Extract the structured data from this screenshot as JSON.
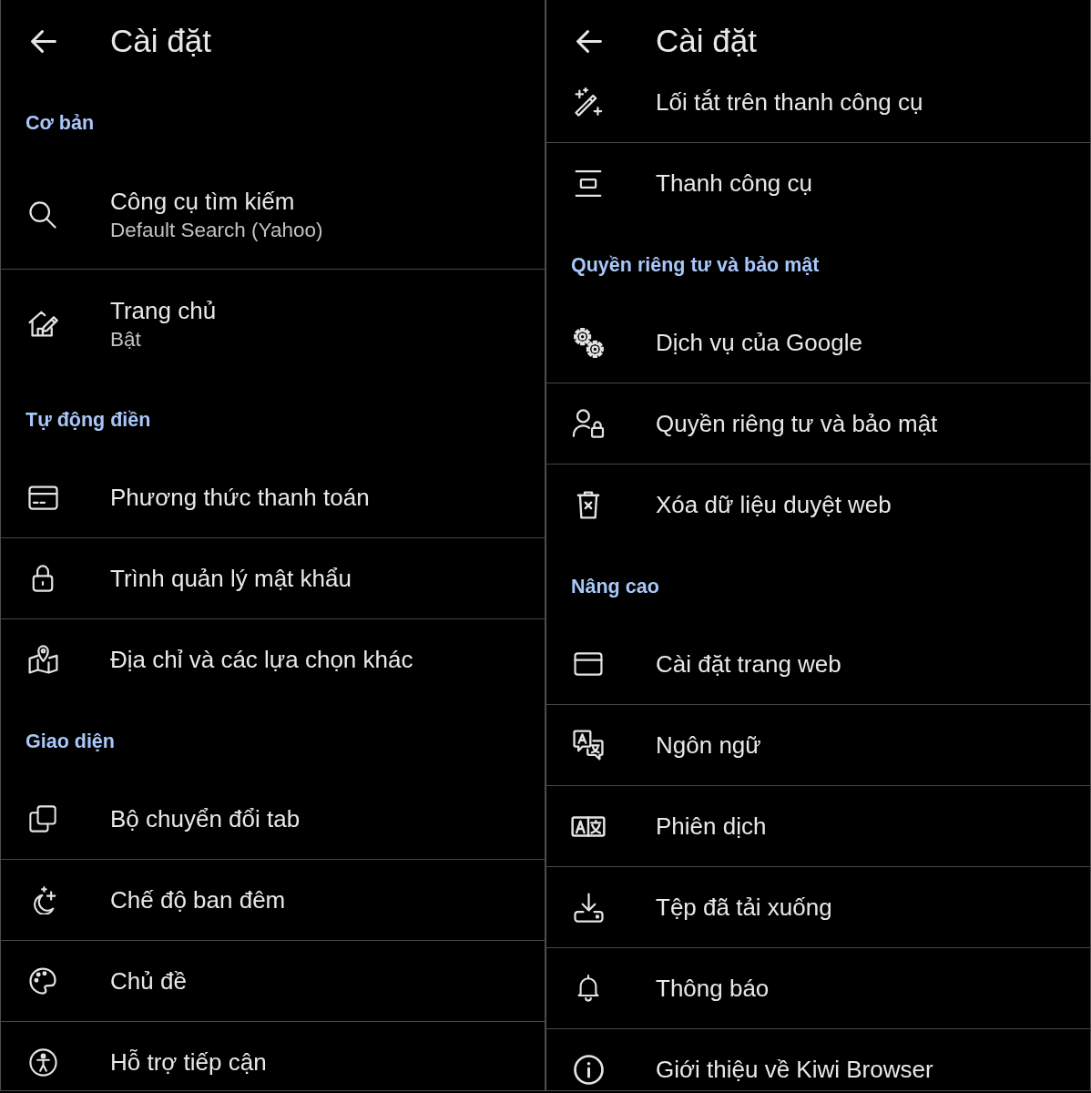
{
  "screens": [
    {
      "title": "Cài đặt",
      "sections": [
        {
          "heading": "Cơ bản",
          "items": [
            {
              "label": "Công cụ tìm kiếm",
              "summary": "Default Search (Yahoo)"
            },
            {
              "label": "Trang chủ",
              "summary": "Bật"
            }
          ]
        },
        {
          "heading": "Tự động điền",
          "items": [
            {
              "label": "Phương thức thanh toán"
            },
            {
              "label": "Trình quản lý mật khẩu"
            },
            {
              "label": "Địa chỉ và các lựa chọn khác"
            }
          ]
        },
        {
          "heading": "Giao diện",
          "items": [
            {
              "label": "Bộ chuyển đổi tab"
            },
            {
              "label": "Chế độ ban đêm"
            },
            {
              "label": "Chủ đề"
            },
            {
              "label": "Hỗ trợ tiếp cận"
            }
          ]
        }
      ]
    },
    {
      "title": "Cài đặt",
      "sections": [
        {
          "items": [
            {
              "label": "Lối tắt trên thanh công cụ"
            },
            {
              "label": "Thanh công cụ"
            }
          ]
        },
        {
          "heading": "Quyền riêng tư và bảo mật",
          "items": [
            {
              "label": "Dịch vụ của Google"
            },
            {
              "label": "Quyền riêng tư và bảo mật"
            },
            {
              "label": "Xóa dữ liệu duyệt web"
            }
          ]
        },
        {
          "heading": "Nâng cao",
          "items": [
            {
              "label": "Cài đặt trang web"
            },
            {
              "label": "Ngôn ngữ"
            },
            {
              "label": "Phiên dịch"
            },
            {
              "label": "Tệp đã tải xuống"
            },
            {
              "label": "Thông báo"
            },
            {
              "label": "Giới thiệu về Kiwi Browser"
            }
          ]
        }
      ]
    }
  ]
}
